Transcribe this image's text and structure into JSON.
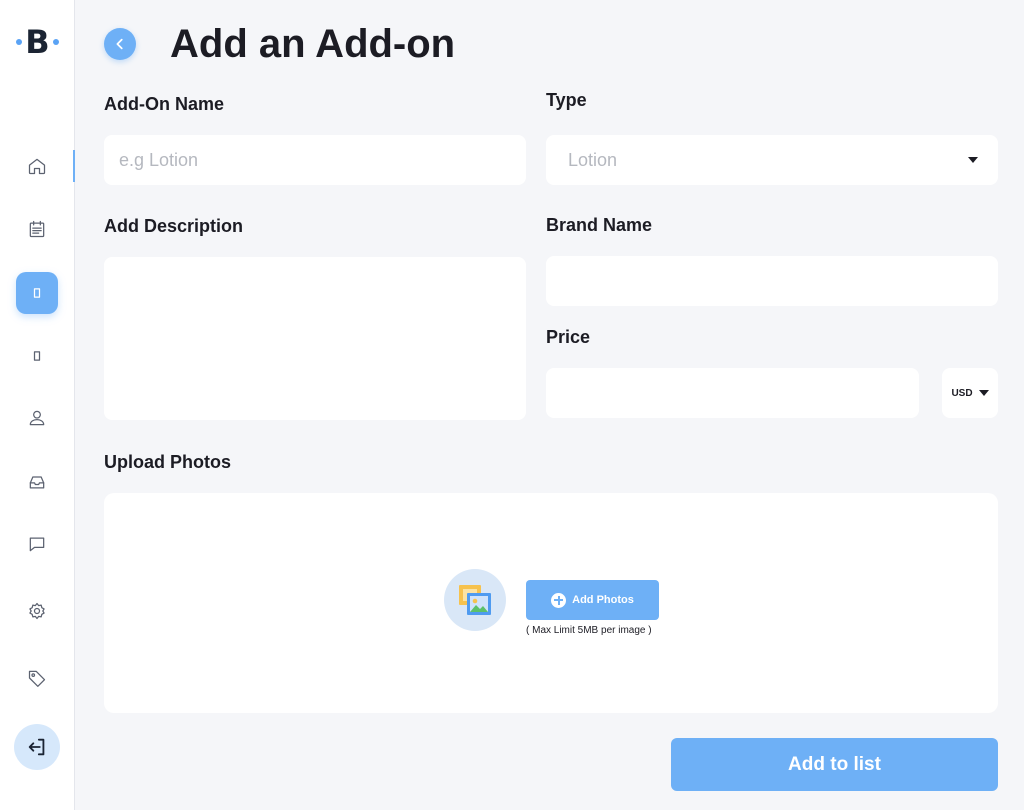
{
  "brand": {
    "logo_letter": "B"
  },
  "sidebar": {
    "items": [
      {
        "icon": "home-icon",
        "active": false
      },
      {
        "icon": "calendar-icon",
        "active": false
      },
      {
        "icon": "box-icon",
        "active": true
      },
      {
        "icon": "box-icon",
        "active": false
      },
      {
        "icon": "user-icon",
        "active": false
      },
      {
        "icon": "inbox-icon",
        "active": false
      },
      {
        "icon": "chat-icon",
        "active": false
      },
      {
        "icon": "gear-icon",
        "active": false
      },
      {
        "icon": "tag-icon",
        "active": false
      }
    ],
    "logout_icon": "logout-icon"
  },
  "header": {
    "title": "Add an Add-on"
  },
  "form": {
    "addon_name": {
      "label": "Add-On Name",
      "placeholder": "e.g Lotion",
      "value": ""
    },
    "type": {
      "label": "Type",
      "value": "Lotion"
    },
    "description": {
      "label": "Add Description",
      "value": ""
    },
    "brand_name": {
      "label": "Brand Name",
      "value": ""
    },
    "price": {
      "label": "Price",
      "value": "",
      "currency": "USD"
    },
    "upload": {
      "label": "Upload Photos",
      "button_label": "Add Photos",
      "hint": "( Max Limit 5MB per image )"
    },
    "submit_label": "Add to list"
  },
  "colors": {
    "accent": "#6eb0f6",
    "background": "#f5f6f9",
    "text": "#1c1c24"
  }
}
